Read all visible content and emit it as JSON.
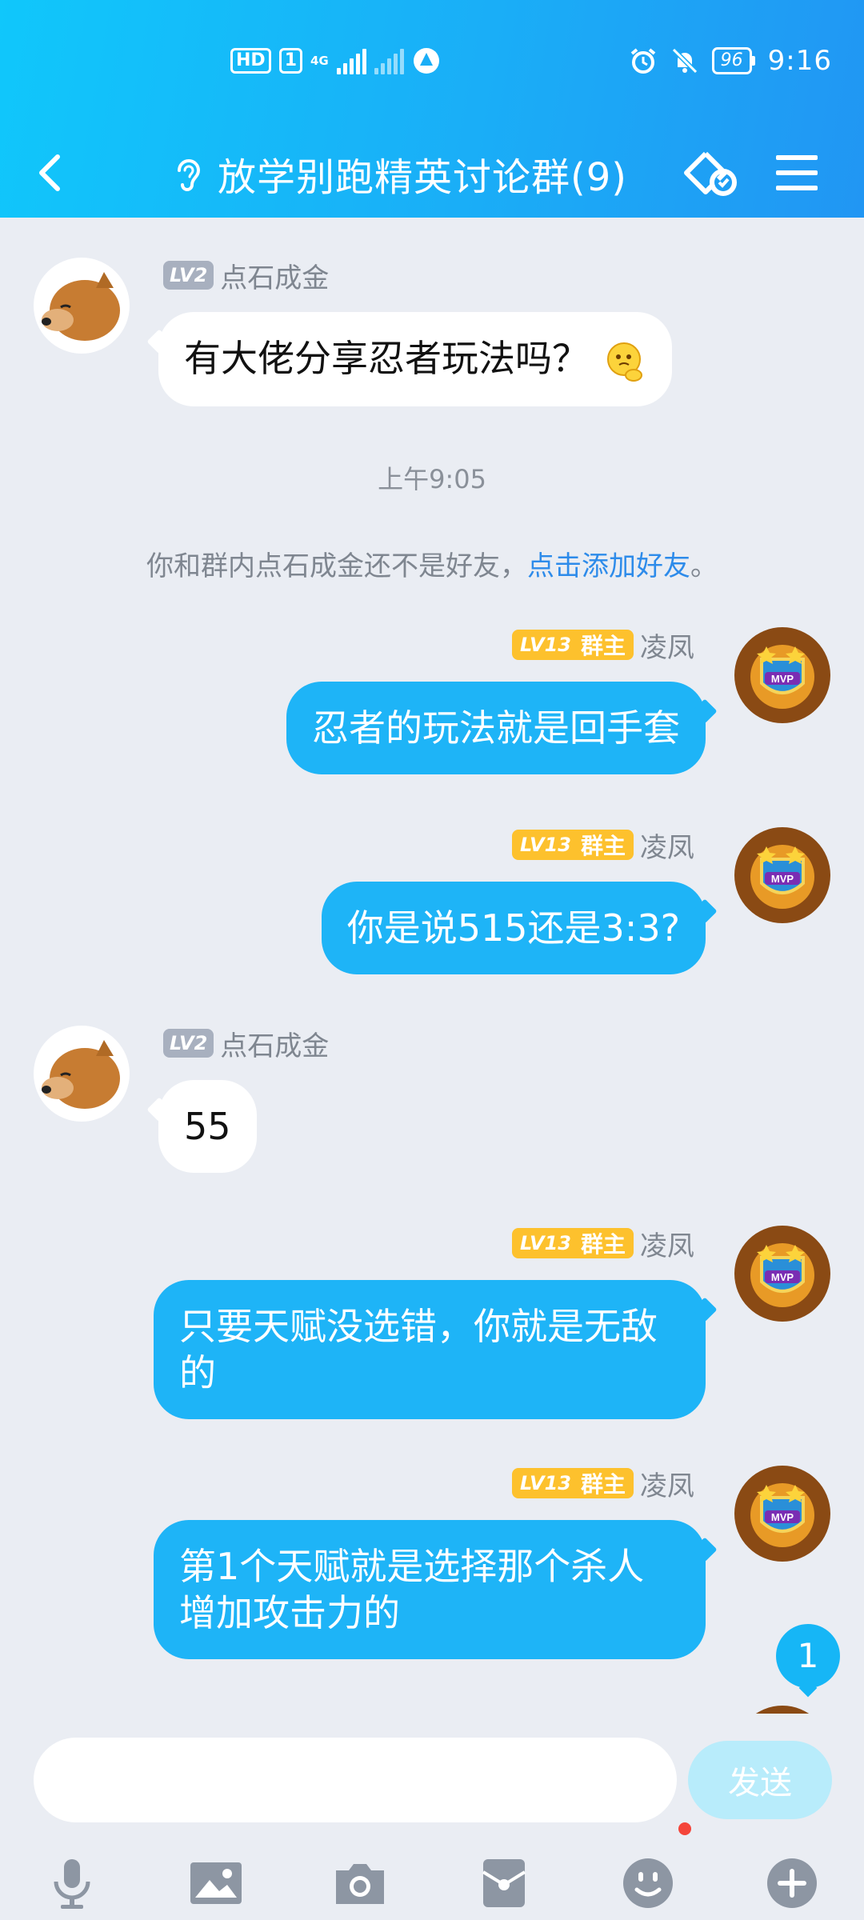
{
  "status_bar": {
    "hd": "HD",
    "sim": "1",
    "network": "4G",
    "battery": "96",
    "time": "9:16"
  },
  "header": {
    "title": "放学别跑精英讨论群(9)"
  },
  "chat": {
    "messages": [
      {
        "sender": "点石成金",
        "level": "LV2",
        "role": "",
        "text": "有大佬分享忍者玩法吗？",
        "side": "left"
      },
      {
        "sender": "凌凤",
        "level": "LV13",
        "role": "群主",
        "text": "忍者的玩法就是回手套",
        "side": "right"
      },
      {
        "sender": "凌凤",
        "level": "LV13",
        "role": "群主",
        "text": "你是说515还是3:3?",
        "side": "right"
      },
      {
        "sender": "点石成金",
        "level": "LV2",
        "role": "",
        "text": "55",
        "side": "left"
      },
      {
        "sender": "凌凤",
        "level": "LV13",
        "role": "群主",
        "text": "只要天赋没选错，你就是无敌的",
        "side": "right"
      },
      {
        "sender": "凌凤",
        "level": "LV13",
        "role": "群主",
        "text": "第1个天赋就是选择那个杀人增加攻击力的",
        "side": "right"
      }
    ],
    "timestamp": "上午9:05",
    "notice_prefix": "你和群内点石成金还不是好友，",
    "notice_link": "点击添加好友",
    "notice_suffix": "。",
    "unread_count": "1"
  },
  "input": {
    "value": "",
    "placeholder": "",
    "send_label": "发送"
  },
  "toolbar": {
    "icons": [
      "microphone-icon",
      "image-icon",
      "camera-icon",
      "red-packet-icon",
      "emoji-icon",
      "plus-icon"
    ]
  },
  "colors": {
    "header_gradient_start": "#10c7fb",
    "header_gradient_end": "#2196f3",
    "own_bubble": "#1eb4f7",
    "owner_badge": "#fdc12d",
    "link": "#2d8bea",
    "background": "#eaedf3"
  }
}
